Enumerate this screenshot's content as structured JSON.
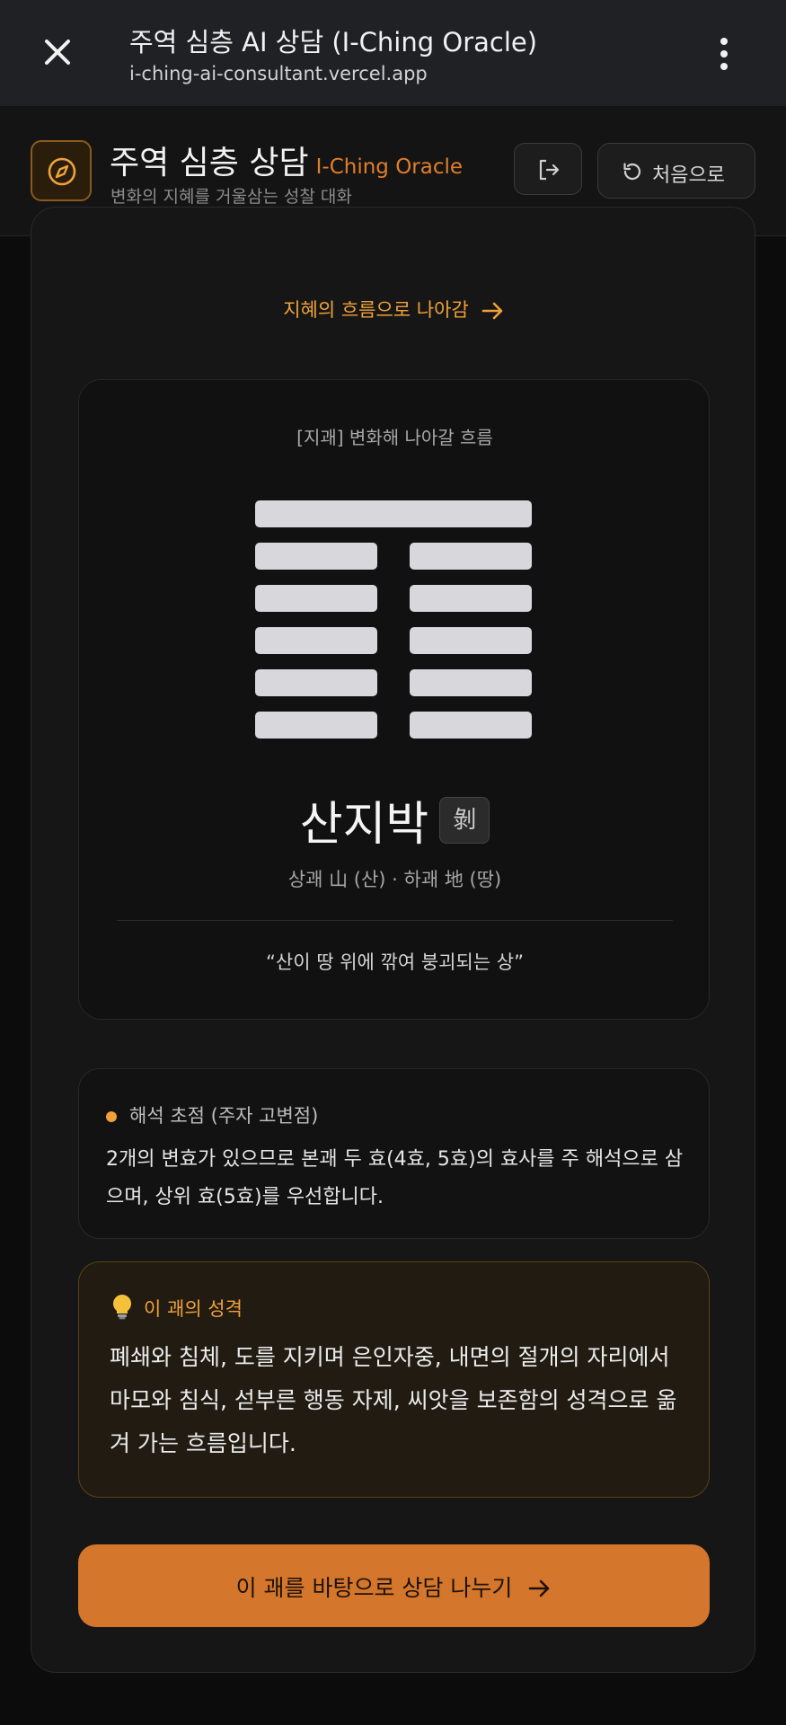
{
  "browser": {
    "title": "주역 심층 AI 상담 (I-Ching Oracle)",
    "url": "i-ching-ai-consultant.vercel.app",
    "close_icon": "close-icon",
    "menu_icon": "kebab-menu-icon"
  },
  "header": {
    "title_ko": "주역 심층 상담",
    "title_en": "I-Ching Oracle",
    "subtitle": "변화의 지혜를 거울삼는 성찰 대화",
    "logo_icon": "compass-icon",
    "logout_icon": "logout-icon",
    "home_button": "처음으로",
    "home_icon": "restart-icon"
  },
  "flow_link": "지혜의 흐름으로 나아감",
  "hexagram": {
    "card_label": "[지괘] 변화해 나아갈 흐름",
    "lines_top_to_bottom": [
      "yang",
      "yin",
      "yin",
      "yin",
      "yin",
      "yin"
    ],
    "name": "산지박",
    "hanja": "剝",
    "trigrams": "상괘 山 (산) · 하괘 地 (땅)",
    "image_quote": "“산이 땅 위에 깎여 붕괴되는 상”"
  },
  "focus": {
    "title": "해석 초점 (주자 고변점)",
    "body": "2개의 변효가 있으므로 본괘 두 효(4효, 5효)의 효사를 주 해석으로 삼으며, 상위 효(5효)를 우선합니다."
  },
  "trait": {
    "icon": "lightbulb-icon",
    "title": "이 괘의 성격",
    "body": "폐쇄와 침체, 도를 지키며 은인자중, 내면의 절개의 자리에서 마모와 침식, 섣부른 행동 자제, 씨앗을 보존함의 성격으로 옮겨 가는 흐름입니다."
  },
  "cta": {
    "label": "이 괘를 바탕으로 상담 나누기"
  },
  "colors": {
    "accent": "#f0a13a",
    "cta_bg": "#d4762b",
    "background": "#0c0c0c",
    "line": "#d8d8dc"
  }
}
